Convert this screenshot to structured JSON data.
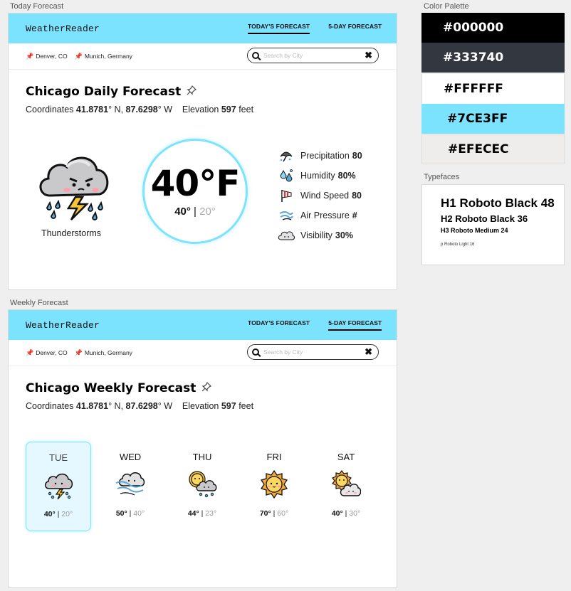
{
  "frames": {
    "today_label": "Today Forecast",
    "weekly_label": "Weekly Forecast",
    "palette_label": "Color Palette",
    "typefaces_label": "Typefaces"
  },
  "header": {
    "brand": "WeatherReader",
    "nav_today": "TODAY'S FORECAST",
    "nav_5day": "5-DAY FORECAST"
  },
  "locations": [
    "Denver, CO",
    "Munich, Germany"
  ],
  "search": {
    "placeholder": "Search by City",
    "clear": "✖"
  },
  "today": {
    "title": "Chicago Daily Forecast",
    "coords_label": "Coordinates",
    "lat": "41.8781",
    "lat_suffix": "° N,",
    "lon": "87.6298",
    "lon_suffix": "° W",
    "elev_label": "Elevation",
    "elev": "597",
    "elev_unit": "feet",
    "condition": "Thunderstorms",
    "temp": "40°F",
    "hi": "40°",
    "sep": "|",
    "lo": "20°",
    "stats": [
      {
        "label": "Precipitation",
        "value": "80",
        "icon": "umbrella-icon"
      },
      {
        "label": "Humidity",
        "value": "80%",
        "icon": "droplets-icon"
      },
      {
        "label": "Wind Speed",
        "value": "80",
        "icon": "windsock-icon"
      },
      {
        "label": "Air Pressure",
        "value": "#",
        "icon": "wind-icon"
      },
      {
        "label": "Visibility",
        "value": "30%",
        "icon": "cloud-icon"
      }
    ]
  },
  "weekly": {
    "title": "Chicago Weekly Forecast",
    "days": [
      {
        "name": "TUE",
        "hi": "40°",
        "lo": "20°",
        "icon": "thunderstorm-icon"
      },
      {
        "name": "WED",
        "hi": "50°",
        "lo": "40°",
        "icon": "windy-rain-icon"
      },
      {
        "name": "THU",
        "hi": "44°",
        "lo": "23°",
        "icon": "sun-rain-icon"
      },
      {
        "name": "FRI",
        "hi": "70°",
        "lo": "60°",
        "icon": "sun-icon"
      },
      {
        "name": "SAT",
        "hi": "40°",
        "lo": "30°",
        "icon": "partly-cloudy-icon"
      }
    ]
  },
  "palette": [
    {
      "hex": "#000000",
      "text": "#FFFFFF"
    },
    {
      "hex": "#333740",
      "text": "#FFFFFF"
    },
    {
      "hex": "#FFFFFF",
      "text": "#000000"
    },
    {
      "hex": "#7CE3FF",
      "text": "#000000"
    },
    {
      "hex": "#EFECEC",
      "text": "#000000"
    }
  ],
  "typefaces": {
    "h1": "H1 Roboto Black 48",
    "h2": "H2 Roboto Black 36",
    "h3": "H3 Roboto Medium 24",
    "p": "p Roboto Light 16"
  }
}
